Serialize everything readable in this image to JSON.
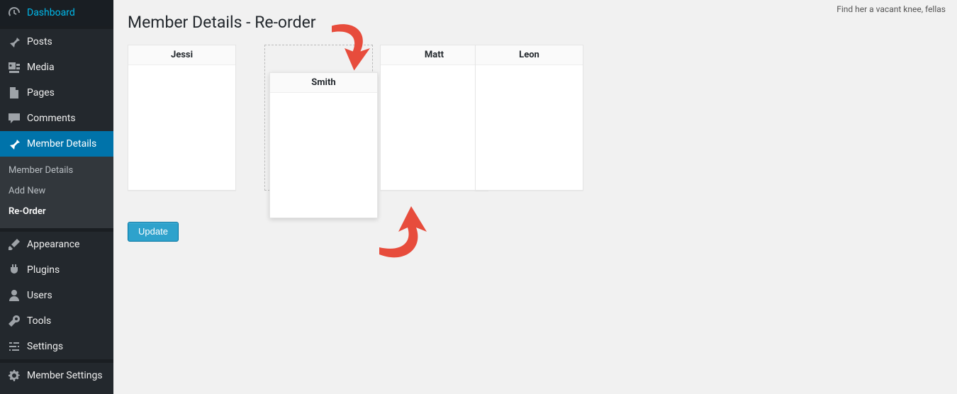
{
  "help_text": "Find her a vacant knee, fellas",
  "page_title": "Member Details - Re-order",
  "sidebar": {
    "items": [
      {
        "label": "Dashboard",
        "icon": "dashboard-icon"
      },
      {
        "label": "Posts",
        "icon": "pin-icon"
      },
      {
        "label": "Media",
        "icon": "media-icon"
      },
      {
        "label": "Pages",
        "icon": "page-icon"
      },
      {
        "label": "Comments",
        "icon": "comment-icon"
      },
      {
        "label": "Member Details",
        "icon": "pin-icon",
        "active": true
      },
      {
        "label": "Appearance",
        "icon": "brush-icon"
      },
      {
        "label": "Plugins",
        "icon": "plug-icon"
      },
      {
        "label": "Users",
        "icon": "user-icon"
      },
      {
        "label": "Tools",
        "icon": "wrench-icon"
      },
      {
        "label": "Settings",
        "icon": "sliders-icon"
      },
      {
        "label": "Member Settings",
        "icon": "gear-icon"
      }
    ],
    "submenu": [
      {
        "label": "Member Details"
      },
      {
        "label": "Add New"
      },
      {
        "label": "Re-Order",
        "current": true
      }
    ]
  },
  "cards": [
    {
      "name": "Jessi"
    },
    {
      "name": "Smith",
      "dragging": true
    },
    {
      "name": "Matt"
    },
    {
      "name": "Leon"
    }
  ],
  "button_label": "Update",
  "colors": {
    "accent": "#0073aa",
    "button": "#2ea2cc",
    "arrow": "#e74c3c"
  }
}
